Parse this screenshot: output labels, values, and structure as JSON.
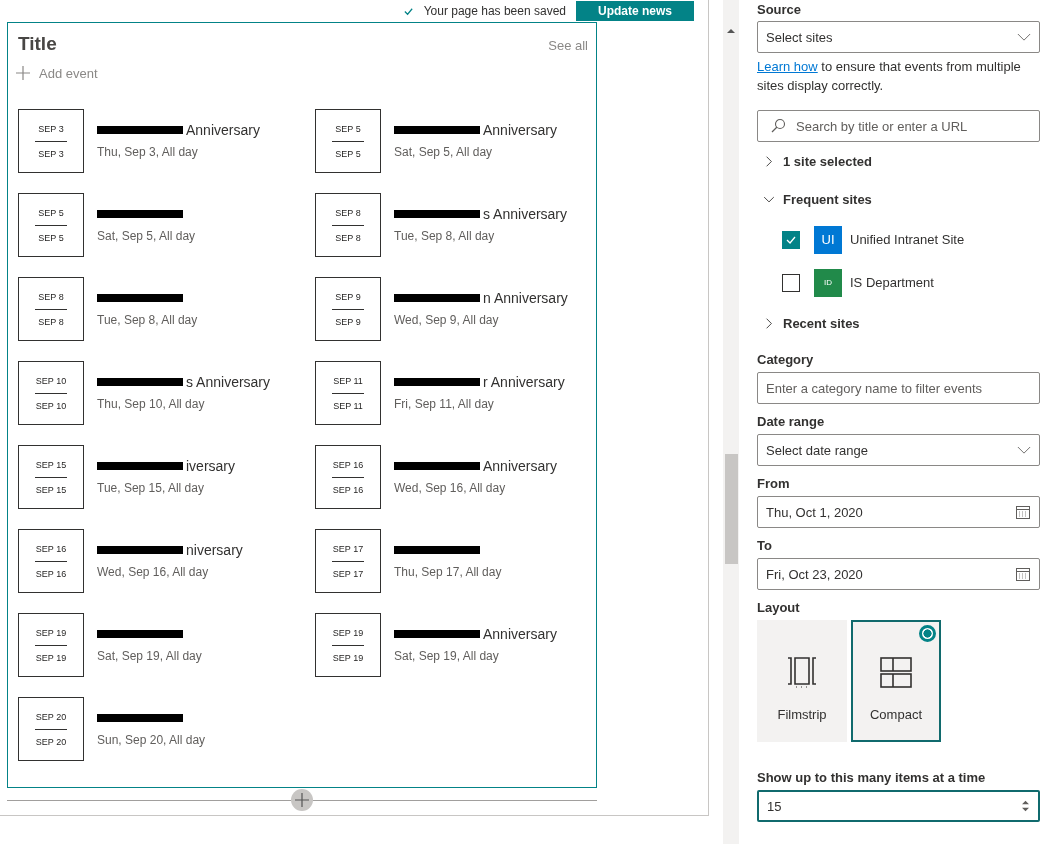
{
  "header": {
    "save_status": "Your page has been saved",
    "update_button": "Update news"
  },
  "webpart": {
    "title": "Title",
    "see_all": "See all",
    "add_event": "Add event",
    "events": [
      {
        "start": "SEP 3",
        "end": "SEP 3",
        "title": "Anniversary",
        "when": "Thu, Sep 3, All day"
      },
      {
        "start": "SEP 5",
        "end": "SEP 5",
        "title": "Anniversary",
        "when": "Sat, Sep 5, All day"
      },
      {
        "start": "SEP 5",
        "end": "SEP 5",
        "when": "Sat, Sep 5, All day"
      },
      {
        "start": "SEP 8",
        "end": "SEP 8",
        "title": "s Anniversary",
        "when": "Tue, Sep 8, All day"
      },
      {
        "start": "SEP 8",
        "end": "SEP 8",
        "when": "Tue, Sep 8, All day"
      },
      {
        "start": "SEP 9",
        "end": "SEP 9",
        "title": "n Anniversary",
        "when": "Wed, Sep 9, All day"
      },
      {
        "start": "SEP 10",
        "end": "SEP 10",
        "title": "s Anniversary",
        "when": "Thu, Sep 10, All day"
      },
      {
        "start": "SEP 11",
        "end": "SEP 11",
        "title": "r Anniversary",
        "when": "Fri, Sep 11, All day"
      },
      {
        "start": "SEP 15",
        "end": "SEP 15",
        "title": "iversary",
        "when": "Tue, Sep 15, All day"
      },
      {
        "start": "SEP 16",
        "end": "SEP 16",
        "title": "Anniversary",
        "when": "Wed, Sep 16, All day"
      },
      {
        "start": "SEP 16",
        "end": "SEP 16",
        "title": "niversary",
        "when": "Wed, Sep 16, All day"
      },
      {
        "start": "SEP 17",
        "end": "SEP 17",
        "when": "Thu, Sep 17, All day"
      },
      {
        "start": "SEP 19",
        "end": "SEP 19",
        "when": "Sat, Sep 19, All day"
      },
      {
        "start": "SEP 19",
        "end": "SEP 19",
        "title": "Anniversary",
        "when": "Sat, Sep 19, All day"
      },
      {
        "start": "SEP 20",
        "end": "SEP 20",
        "when": "Sun, Sep 20, All day"
      }
    ]
  },
  "panel": {
    "source": {
      "label": "Source",
      "value": "Select sites"
    },
    "help": {
      "link": "Learn how",
      "text": " to ensure that events from multiple sites display correctly."
    },
    "search": {
      "placeholder": "Search by title or enter a URL"
    },
    "groups": [
      {
        "label": "1 site selected",
        "expanded": false
      },
      {
        "label": "Frequent sites",
        "expanded": true,
        "sites": [
          {
            "initials": "UI",
            "name": "Unified Intranet Site",
            "checked": true,
            "color": "#0078d4"
          },
          {
            "initials": "ID",
            "name": "IS Department",
            "checked": false,
            "color": "#218a4a"
          }
        ]
      },
      {
        "label": "Recent sites",
        "expanded": false
      }
    ],
    "category": {
      "label": "Category",
      "placeholder": "Enter a category name to filter events"
    },
    "date_range": {
      "label": "Date range",
      "value": "Select date range"
    },
    "from": {
      "label": "From",
      "value": "Thu, Oct 1, 2020"
    },
    "to": {
      "label": "To",
      "value": "Fri, Oct 23, 2020"
    },
    "layout": {
      "label": "Layout",
      "options": [
        {
          "label": "Filmstrip",
          "kind": "filmstrip",
          "selected": false
        },
        {
          "label": "Compact",
          "kind": "compact",
          "selected": true
        }
      ]
    },
    "count": {
      "label": "Show up to this many items at a time",
      "value": "15"
    }
  }
}
